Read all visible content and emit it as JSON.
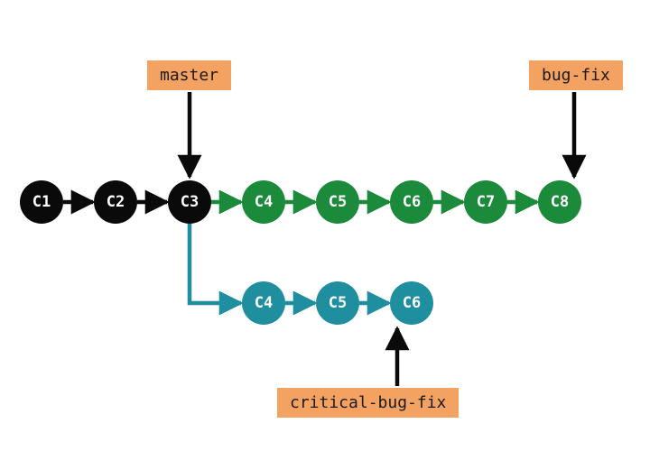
{
  "colors": {
    "black": "#0a0a0a",
    "green": "#1b8a3a",
    "teal": "#1f8e9e",
    "label_bg": "#f4a261",
    "white": "#ffffff"
  },
  "branches": {
    "master": {
      "label": "master",
      "points_to": "C3",
      "color": "black"
    },
    "bug_fix": {
      "label": "bug-fix",
      "points_to": "C8",
      "color": "green"
    },
    "critical_bug_fix": {
      "label": "critical-bug-fix",
      "points_to": "C6",
      "color": "teal"
    }
  },
  "commits": {
    "main_row": [
      {
        "id": "C1",
        "label": "C1",
        "color": "black"
      },
      {
        "id": "C2",
        "label": "C2",
        "color": "black"
      },
      {
        "id": "C3",
        "label": "C3",
        "color": "black"
      },
      {
        "id": "C4",
        "label": "C4",
        "color": "green"
      },
      {
        "id": "C5",
        "label": "C5",
        "color": "green"
      },
      {
        "id": "C6",
        "label": "C6",
        "color": "green"
      },
      {
        "id": "C7",
        "label": "C7",
        "color": "green"
      },
      {
        "id": "C8",
        "label": "C8",
        "color": "green"
      }
    ],
    "branch_row": [
      {
        "id": "bC4",
        "label": "C4",
        "color": "teal"
      },
      {
        "id": "bC5",
        "label": "C5",
        "color": "teal"
      },
      {
        "id": "bC6",
        "label": "C6",
        "color": "teal"
      }
    ]
  },
  "edges": [
    {
      "from": "C1",
      "to": "C2",
      "color": "black"
    },
    {
      "from": "C2",
      "to": "C3",
      "color": "black"
    },
    {
      "from": "C3",
      "to": "C4",
      "color": "green"
    },
    {
      "from": "C4",
      "to": "C5",
      "color": "green"
    },
    {
      "from": "C5",
      "to": "C6",
      "color": "green"
    },
    {
      "from": "C6",
      "to": "C7",
      "color": "green"
    },
    {
      "from": "C7",
      "to": "C8",
      "color": "green"
    },
    {
      "from": "C3",
      "to": "bC4",
      "color": "teal",
      "elbow": true
    },
    {
      "from": "bC4",
      "to": "bC5",
      "color": "teal"
    },
    {
      "from": "bC5",
      "to": "bC6",
      "color": "teal"
    }
  ]
}
